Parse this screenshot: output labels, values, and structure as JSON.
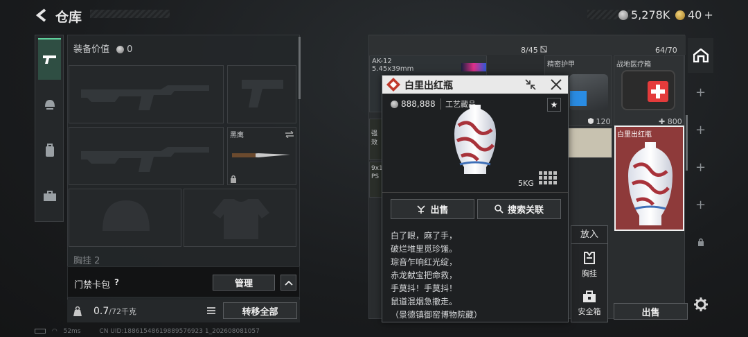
{
  "header": {
    "title": "仓库",
    "silver": "5,278K",
    "gold": "40",
    "plus": "+"
  },
  "left": {
    "equip_value_label": "装备价值",
    "equip_value": "0",
    "knife_name": "黑鹰",
    "chest_label": "胸挂",
    "chest_value": "2",
    "card_label": "门禁卡包",
    "card_help": "?",
    "manage_label": "管理",
    "weight_current": "0.7",
    "weight_total": "/72千克",
    "transfer_all": "转移全部"
  },
  "stash": {
    "count1": "8/45",
    "count2": "64/70",
    "item_ak": "AK-12",
    "item_ak_cal": "5.45x39mm",
    "item_armor": "精密护甲",
    "item_medkit": "战地医疗箱",
    "armor_value": "120",
    "medkit_value": "800",
    "item_vase": "白里出红瓶",
    "cut_label": "强效",
    "cut_label2": "9x1",
    "cut_label3": "PS"
  },
  "popup": {
    "title": "白里出红瓶",
    "price": "888,888",
    "category": "工艺藏品",
    "weight": "5KG",
    "sell_label": "出售",
    "search_label": "搜索关联",
    "poem": [
      "白了眼，麻了手，",
      "破烂堆里觅珍馐。",
      "琮音乍响红光绽，",
      "赤龙献宝把命救，",
      "手莫抖！手莫抖！",
      "鼠道混烟急撤走。",
      "（景德镇御窑博物院藏）"
    ]
  },
  "place": {
    "title": "放入",
    "chest": "胸挂",
    "safe": "安全箱",
    "sell": "出售"
  },
  "footer": {
    "ping": "52ms",
    "uid": "CN UID:18861548619889576923 1_202608081057"
  },
  "colors": {
    "accent": "#5fd09c",
    "vase_red": "#b13a3a",
    "header_bg": "#e9e9e9"
  }
}
